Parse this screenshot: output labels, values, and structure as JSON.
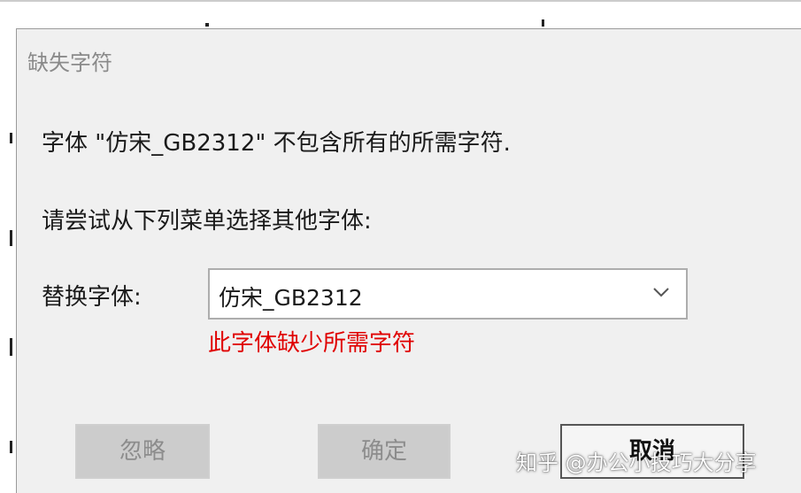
{
  "dialog": {
    "title": "缺失字符",
    "message_line1": "字体 \"仿宋_GB2312\" 不包含所有的所需字符.",
    "message_line2": "请尝试从下列菜单选择其他字体:",
    "replace_label": "替换字体:",
    "font_select": {
      "value": "仿宋_GB2312"
    },
    "warning": "此字体缺少所需字符",
    "buttons": {
      "ignore": "忽略",
      "ok": "确定",
      "cancel": "取消"
    }
  },
  "watermark": "知乎 @办公小技巧大分享",
  "colors": {
    "warning": "#e00000",
    "dialog_bg": "#f0f0f0"
  },
  "icons": {
    "dropdown": "chevron-down-icon"
  }
}
